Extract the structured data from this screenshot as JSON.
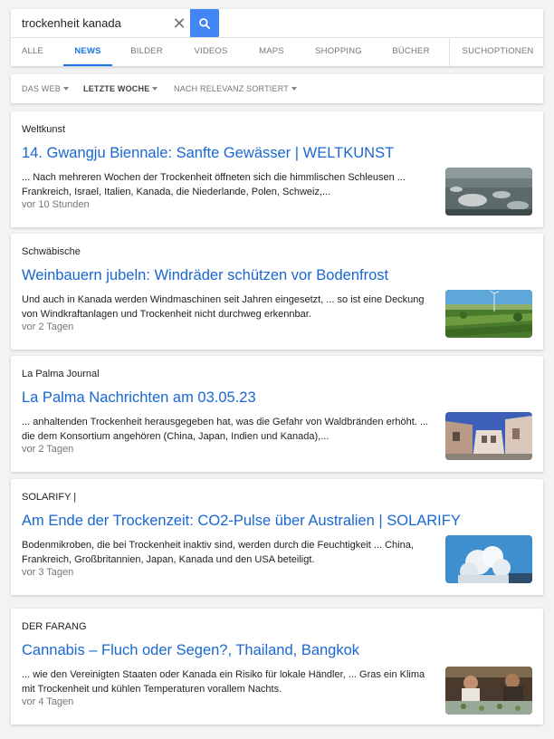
{
  "search": {
    "query": "trockenheit kanada",
    "placeholder": ""
  },
  "tabs": [
    {
      "label": "ALLE",
      "active": false
    },
    {
      "label": "NEWS",
      "active": true
    },
    {
      "label": "BILDER",
      "active": false
    },
    {
      "label": "VIDEOS",
      "active": false
    },
    {
      "label": "MAPS",
      "active": false
    },
    {
      "label": "SHOPPING",
      "active": false
    },
    {
      "label": "BÜCHER",
      "active": false
    },
    {
      "label": "SUCHOPTIONEN",
      "active": false
    }
  ],
  "filters": [
    {
      "label": "DAS WEB"
    },
    {
      "label": "LETZTE WOCHE"
    },
    {
      "label": "NACH RELEVANZ SORTIERT"
    }
  ],
  "results": [
    {
      "source": "Weltkunst",
      "title": "14. Gwangju Biennale: Sanfte Gewässer | WELTKUNST",
      "snippet": "... Nach mehreren Wochen der Trockenheit öffneten sich die himmlischen Schleusen ... Frankreich, Israel, Italien, Kanada, die Niederlande, Polen, Schweiz,...",
      "time": "vor 10 Stunden",
      "thumb": "art-installation-thumbnail"
    },
    {
      "source": "Schwäbische",
      "title": "Weinbauern jubeln: Windräder schützen vor Bodenfrost",
      "snippet": "Und auch in Kanada werden Windmaschinen seit Jahren eingesetzt, ... so ist eine Deckung von Windkraftanlagen und Trockenheit nicht durchweg erkennbar.",
      "time": "vor 2 Tagen",
      "thumb": "vineyard-thumbnail"
    },
    {
      "source": "La Palma Journal",
      "title": "La Palma Nachrichten am 03.05.23",
      "snippet": "... anhaltenden Trockenheit herausgegeben hat, was die Gefahr von Waldbränden erhöht. ... die dem Konsortium angehören (China, Japan, Indien und Kanada),...",
      "time": "vor 2 Tagen",
      "thumb": "street-thumbnail"
    },
    {
      "source": "SOLARIFY |",
      "title": "Am Ende der Trockenzeit: CO2-Pulse über Australien | SOLARIFY",
      "snippet": "Bodenmikroben, die bei Trockenheit inaktiv sind, werden durch die Feuchtigkeit ... China, Frankreich, Großbritannien, Japan, Kanada und den USA beteiligt.",
      "time": "vor 3 Tagen",
      "thumb": "steam-cloud-thumbnail"
    },
    {
      "source": "DER FARANG",
      "title": "Cannabis – Fluch oder Segen?, Thailand, Bangkok",
      "snippet": "... wie den Vereinigten Staaten oder Kanada ein Risiko für lokale Händler, ... Gras ein Klima mit Trockenheit und kühlen Temperaturen vorallem Nachts.",
      "time": "vor 4 Tagen",
      "thumb": "shop-thumbnail"
    }
  ],
  "colors": {
    "accent": "#1a73e8",
    "link": "#1967d2",
    "search_button": "#4285f4"
  }
}
